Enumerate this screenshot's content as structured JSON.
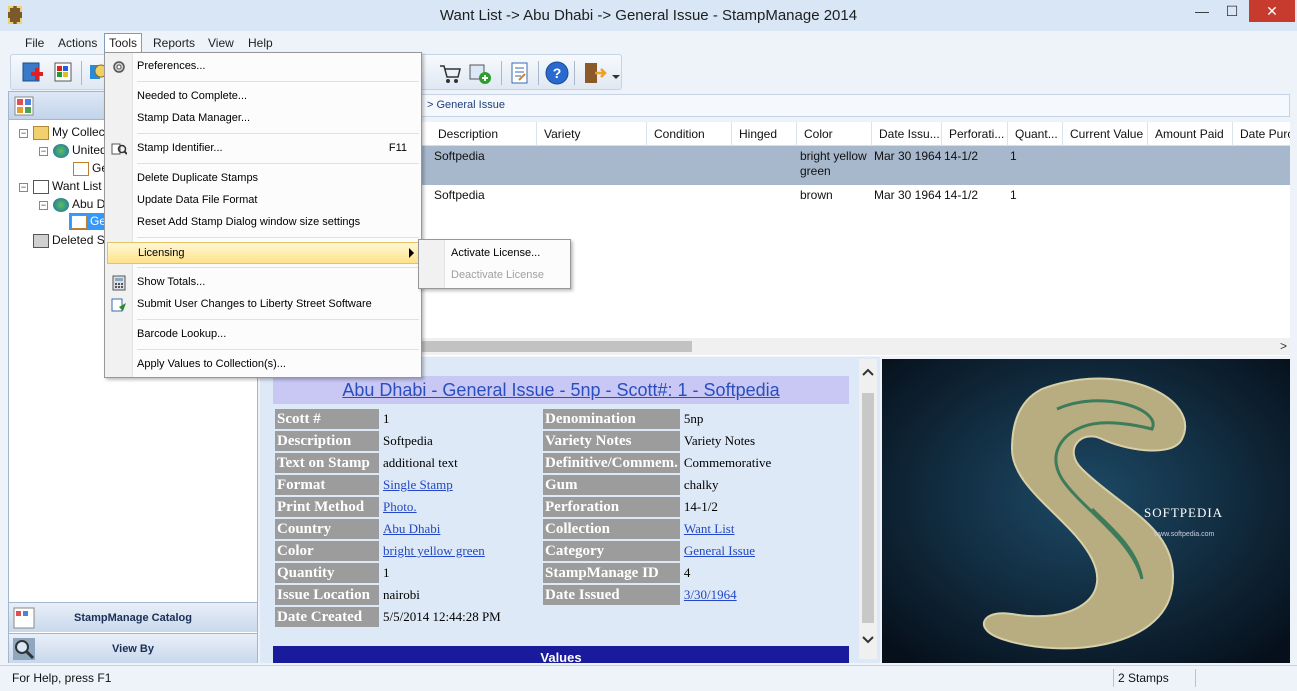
{
  "window": {
    "title": "Want List -> Abu Dhabi -> General Issue - StampManage 2014",
    "minimize": "—",
    "maximize": "☐",
    "close": "✕"
  },
  "menubar": {
    "file": "File",
    "actions": "Actions",
    "tools": "Tools",
    "reports": "Reports",
    "view": "View",
    "help": "Help"
  },
  "tools_menu": {
    "preferences": "Preferences...",
    "needed_to_complete": "Needed to Complete...",
    "stamp_data_manager": "Stamp Data Manager...",
    "stamp_identifier": "Stamp Identifier...",
    "stamp_identifier_shortcut": "F11",
    "delete_duplicate": "Delete Duplicate Stamps",
    "update_data_file": "Update Data File Format",
    "reset_dialog": "Reset Add Stamp Dialog window size settings",
    "licensing": "Licensing",
    "show_totals": "Show Totals...",
    "submit_changes": "Submit User Changes to Liberty Street Software",
    "barcode_lookup": "Barcode Lookup...",
    "apply_values": "Apply Values to Collection(s)..."
  },
  "licensing_submenu": {
    "activate": "Activate License...",
    "deactivate": "Deactivate License"
  },
  "tree": {
    "my_collection": "My Collec",
    "united": "United",
    "ge1": "Ge",
    "want_list": "Want List",
    "abu": "Abu D",
    "ge2": "Ge",
    "deleted": "Deleted S"
  },
  "left_nav": {
    "catalog": "StampManage Catalog",
    "view_by": "View By"
  },
  "breadcrumb": {
    "text": "> General Issue",
    "close": "✕"
  },
  "grid": {
    "columns": [
      "Description",
      "Variety",
      "Condition",
      "Hinged",
      "Color",
      "Date Issu...",
      "Perforati...",
      "Quant...",
      "Current Value",
      "Amount Paid",
      "Date Purc"
    ],
    "rows": [
      {
        "description": "Softpedia",
        "color": "bright yellow green",
        "date": "Mar 30 1964",
        "perf": "14-1/2",
        "qty": "1"
      },
      {
        "description": "Softpedia",
        "color": "brown",
        "date": "Mar 30 1964",
        "perf": "14-1/2",
        "qty": "1"
      }
    ],
    "scroll_right": ">"
  },
  "detail": {
    "title": "Abu Dhabi - General Issue - 5np - Scott#: 1 - Softpedia",
    "rows": [
      {
        "l1": "Scott #",
        "v1": "1",
        "v1link": false,
        "l2": "Denomination",
        "v2": "5np",
        "v2link": false
      },
      {
        "l1": "Description",
        "v1": "Softpedia",
        "v1link": false,
        "l2": "Variety Notes",
        "v2": "Variety Notes",
        "v2link": false
      },
      {
        "l1": "Text on Stamp",
        "v1": "additional text",
        "v1link": false,
        "l2": "Definitive/Commem.",
        "v2": "Commemorative",
        "v2link": false
      },
      {
        "l1": "Format",
        "v1": "Single Stamp",
        "v1link": true,
        "l2": "Gum",
        "v2": "chalky",
        "v2link": false
      },
      {
        "l1": "Print Method",
        "v1": "Photo.",
        "v1link": true,
        "l2": "Perforation",
        "v2": "14-1/2",
        "v2link": false
      },
      {
        "l1": "Country",
        "v1": "Abu Dhabi",
        "v1link": true,
        "l2": "Collection",
        "v2": "Want List",
        "v2link": true
      },
      {
        "l1": "Color",
        "v1": "bright yellow green",
        "v1link": true,
        "l2": "Category",
        "v2": "General Issue",
        "v2link": true
      },
      {
        "l1": "Quantity",
        "v1": "1",
        "v1link": false,
        "l2": "StampManage ID",
        "v2": "4",
        "v2link": false
      },
      {
        "l1": "Issue Location",
        "v1": "nairobi",
        "v1link": false,
        "l2": "Date Issued",
        "v2": "3/30/1964",
        "v2link": true
      },
      {
        "l1": "Date Created",
        "v1": "5/5/2014 12:44:28 PM",
        "v1link": false,
        "l2": "",
        "v2": "",
        "v2link": false
      }
    ],
    "values_header": "Values"
  },
  "image": {
    "brand": "SOFTPEDIA",
    "url": "www.softpedia.com"
  },
  "statusbar": {
    "help": "For Help, press F1",
    "count": "2 Stamps"
  },
  "colors": {
    "accent": "#2347c6",
    "selected_row": "#a7b8cc",
    "label_bg": "#9c9c9c",
    "values_bar": "#1a1a9c"
  }
}
